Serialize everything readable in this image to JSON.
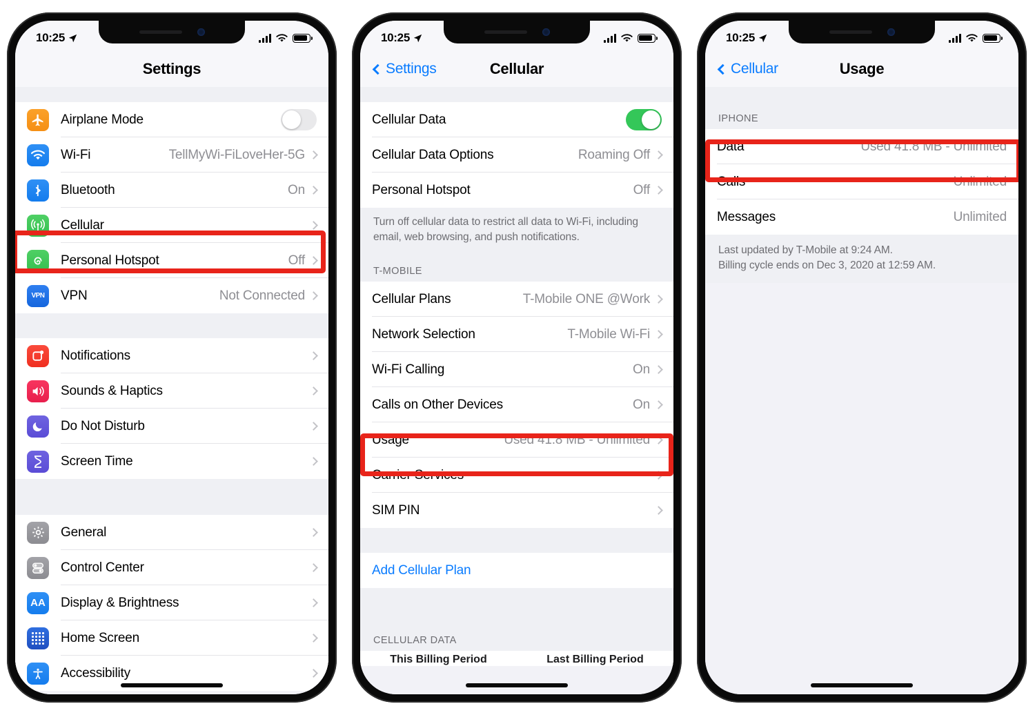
{
  "status_bar": {
    "time": "10:25",
    "location_icon": "location-arrow-icon",
    "signal_icon": "signal-bars-icon",
    "wifi_icon": "wifi-icon",
    "battery_icon": "battery-icon"
  },
  "phone1": {
    "nav": {
      "title": "Settings"
    },
    "group1": [
      {
        "label": "Airplane Mode",
        "icon": "airplane-icon",
        "control": "toggle-off",
        "value": ""
      },
      {
        "label": "Wi-Fi",
        "icon": "wifi-icon",
        "control": "chevron",
        "value": "TellMyWi-FiLoveHer-5G"
      },
      {
        "label": "Bluetooth",
        "icon": "bluetooth-icon",
        "control": "chevron",
        "value": "On"
      },
      {
        "label": "Cellular",
        "icon": "cellular-icon",
        "control": "chevron",
        "value": ""
      },
      {
        "label": "Personal Hotspot",
        "icon": "hotspot-icon",
        "control": "chevron",
        "value": "Off"
      },
      {
        "label": "VPN",
        "icon": "vpn-icon",
        "control": "chevron",
        "value": "Not Connected"
      }
    ],
    "group2": [
      {
        "label": "Notifications",
        "icon": "notifications-icon",
        "control": "chevron",
        "value": ""
      },
      {
        "label": "Sounds & Haptics",
        "icon": "sounds-icon",
        "control": "chevron",
        "value": ""
      },
      {
        "label": "Do Not Disturb",
        "icon": "do-not-disturb-icon",
        "control": "chevron",
        "value": ""
      },
      {
        "label": "Screen Time",
        "icon": "screen-time-icon",
        "control": "chevron",
        "value": ""
      }
    ],
    "group3": [
      {
        "label": "General",
        "icon": "general-gear-icon",
        "control": "chevron",
        "value": ""
      },
      {
        "label": "Control Center",
        "icon": "control-center-icon",
        "control": "chevron",
        "value": ""
      },
      {
        "label": "Display & Brightness",
        "icon": "display-brightness-icon",
        "control": "chevron",
        "value": ""
      },
      {
        "label": "Home Screen",
        "icon": "home-screen-icon",
        "control": "chevron",
        "value": ""
      },
      {
        "label": "Accessibility",
        "icon": "accessibility-icon",
        "control": "chevron",
        "value": ""
      }
    ]
  },
  "phone2": {
    "nav": {
      "back": "Settings",
      "title": "Cellular"
    },
    "group1": [
      {
        "label": "Cellular Data",
        "control": "toggle-on",
        "value": ""
      },
      {
        "label": "Cellular Data Options",
        "control": "chevron",
        "value": "Roaming Off"
      },
      {
        "label": "Personal Hotspot",
        "control": "chevron",
        "value": "Off"
      }
    ],
    "footnote": "Turn off cellular data to restrict all data to Wi-Fi, including email, web browsing, and push notifications.",
    "section_header": "T-MOBILE",
    "group2": [
      {
        "label": "Cellular Plans",
        "control": "chevron",
        "value": "T-Mobile ONE @Work"
      },
      {
        "label": "Network Selection",
        "control": "chevron",
        "value": "T-Mobile Wi-Fi"
      },
      {
        "label": "Wi-Fi Calling",
        "control": "chevron",
        "value": "On"
      },
      {
        "label": "Calls on Other Devices",
        "control": "chevron",
        "value": "On"
      },
      {
        "label": "Usage",
        "control": "chevron",
        "value": "Used 41.8 MB - Unlimited"
      },
      {
        "label": "Carrier Services",
        "control": "chevron",
        "value": ""
      },
      {
        "label": "SIM PIN",
        "control": "chevron",
        "value": ""
      }
    ],
    "add_plan": "Add Cellular Plan",
    "bottom_header": "CELLULAR DATA",
    "billing_tabs": [
      "This Billing Period",
      "Last Billing Period"
    ]
  },
  "phone3": {
    "nav": {
      "back": "Cellular",
      "title": "Usage"
    },
    "section_header": "IPHONE",
    "rows": [
      {
        "label": "Data",
        "value": "Used 41.8 MB - Unlimited"
      },
      {
        "label": "Calls",
        "value": "Unlimited"
      },
      {
        "label": "Messages",
        "value": "Unlimited"
      }
    ],
    "footnote_line1": "Last updated by T-Mobile at 9:24 AM.",
    "footnote_line2": "Billing cycle ends on Dec 3, 2020 at 12:59 AM."
  },
  "colors": {
    "accent_blue": "#0a7cff",
    "toggle_green": "#34c759",
    "highlight_red": "#e8241a",
    "value_gray": "#8e8e93"
  }
}
